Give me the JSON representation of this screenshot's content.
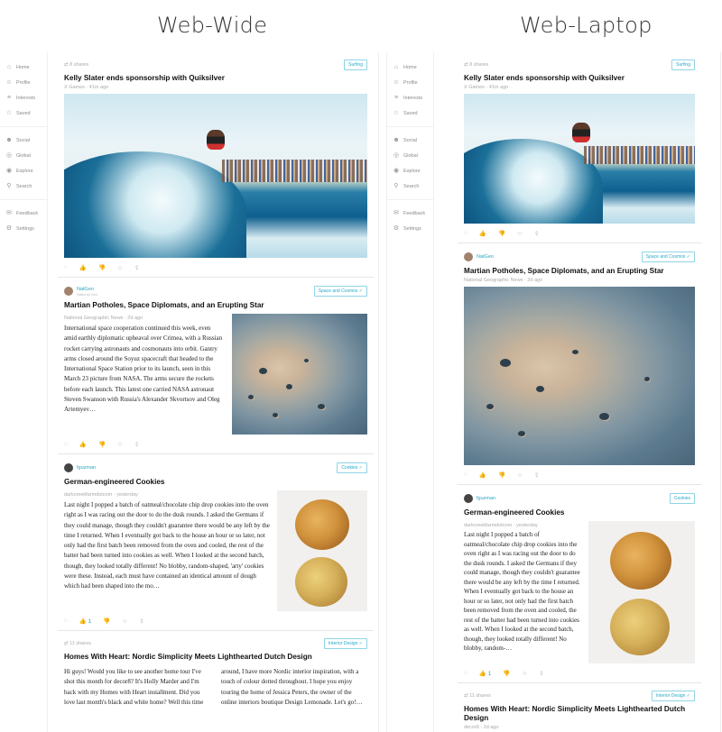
{
  "headings": {
    "wide": "Web-Wide",
    "laptop": "Web-Laptop"
  },
  "sidebar": {
    "top": [
      {
        "label": "Home",
        "icon": "home-icon"
      },
      {
        "label": "Profile",
        "icon": "user-icon"
      },
      {
        "label": "Interests",
        "icon": "list-icon"
      },
      {
        "label": "Saved",
        "icon": "star-icon"
      }
    ],
    "middle": [
      {
        "label": "Social",
        "icon": "people-icon"
      },
      {
        "label": "Global",
        "icon": "globe-icon"
      },
      {
        "label": "Explore",
        "icon": "compass-icon"
      },
      {
        "label": "Search",
        "icon": "search-icon"
      }
    ],
    "bottom": [
      {
        "label": "Feedback",
        "icon": "chat-icon"
      },
      {
        "label": "Settings",
        "icon": "gear-icon"
      }
    ]
  },
  "posts": {
    "surf": {
      "shares": "8 shares",
      "tag": "Surfing",
      "title": "Kelly Slater ends sponsorship with Quiksilver",
      "byline": "X Games · 41m ago"
    },
    "mars": {
      "source": "NatGeo",
      "source_sub": "National Geo",
      "tag": "Space and Cosmos",
      "title": "Martian Potholes, Space Diplomats, and an Erupting Star",
      "byline": "National Geographic News · 2d ago",
      "text": "International space cooperation continued this week, even amid earthly diplomatic upheaval over Crimea, with a Russian rocket carrying astronauts and cosmonauts into orbit. Gantry arms closed around the Soyuz spacecraft that headed to the International Space Station prior to its launch, seen in this March 23 picture from NASA. The arms secure the rockets before each launch. This latest one carried NASA astronaut Steven Swanson with Russia's Alexander Skvortsov and Oleg Artemyev…"
    },
    "cookies": {
      "source": "fguzman",
      "tag": "Cookies",
      "title": "German-engineered Cookies",
      "byline": "darkcreekfarmdotcom · yesterday",
      "likes": "1",
      "text_wide": "Last night I popped a batch of oatmeal/chocolate chip drop cookies into the oven right as I was racing out the door to do the dusk rounds. I asked the Germans if they could manage, though they couldn't guarantee there would be any left by the time I returned. When I eventually got back to the house an hour or so later, not only had the first batch been removed from the oven and cooled, the rest of the batter had been turned into cookies as well. When I looked at the second batch, though, they looked totally different! No blobby, random-shaped, 'arty' cookies were these. Instead, each must have contained an identical amount of dough which had been shaped into the mo…",
      "text_laptop": "Last night I popped a batch of oatmeal/chocolate chip drop cookies into the oven right as I was racing out the door to do the dusk rounds. I asked the Germans if they could manage, though they couldn't guarantee there would be any left by the time I returned. When I eventually got back to the house an hour or so later, not only had the first batch been removed from the oven and cooled, the rest of the batter had been turned into cookies as well. When I looked at the second batch, though, they looked totally different! No blobby, random-…"
    },
    "homes": {
      "shares": "11 shares",
      "tag": "Interior Design",
      "title": "Homes With Heart: Nordic Simplicity Meets Lighthearted Dutch Design",
      "byline": "decor8 · 2d ago",
      "text_left": "Hi guys! Would you like to see another home tour I've shot this month for decor8? It's Holly Marder and I'm back with my Homes with Heart installment. Did you love last month's black and white home? Well this time",
      "text_right": "around, I have more Nordic interior inspiration, with a touch of colour dotted throughout. I hope you enjoy touring the home of Jessica Peters, the owner of the online interiors boutique Design Lemonade. Let's go!…"
    }
  }
}
